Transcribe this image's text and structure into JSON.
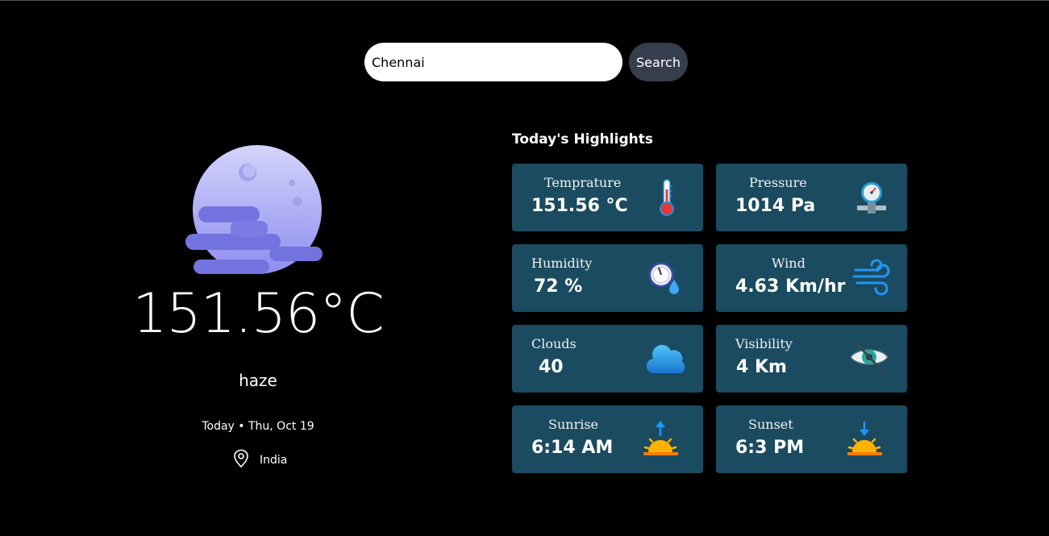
{
  "search": {
    "value": "Chennai",
    "button_label": "Search"
  },
  "current": {
    "temperature": "151.56°C",
    "condition": "haze",
    "date": "Today • Thu, Oct 19",
    "location": "India",
    "icon": "moon-haze-icon"
  },
  "highlights": {
    "title": "Today's Highlights",
    "cards": [
      {
        "label": "Temprature",
        "value": "151.56 °C",
        "icon": "thermometer-icon"
      },
      {
        "label": "Pressure",
        "value": "1014 Pa",
        "icon": "pressure-gauge-icon"
      },
      {
        "label": "Humidity",
        "value": "72 %",
        "icon": "humidity-icon"
      },
      {
        "label": "Wind",
        "value": "4.63 Km/hr",
        "icon": "wind-icon"
      },
      {
        "label": "Clouds",
        "value": "40",
        "icon": "cloud-icon"
      },
      {
        "label": "Visibility",
        "value": "4 Km",
        "icon": "visibility-icon"
      },
      {
        "label": "Sunrise",
        "value": "6:14 AM",
        "icon": "sunrise-icon"
      },
      {
        "label": "Sunset",
        "value": "6:3 PM",
        "icon": "sunset-icon"
      }
    ]
  },
  "colors": {
    "background": "#000000",
    "card": "#1a4b60",
    "search_button": "#363d4d",
    "moon": "#a8a8f0"
  }
}
